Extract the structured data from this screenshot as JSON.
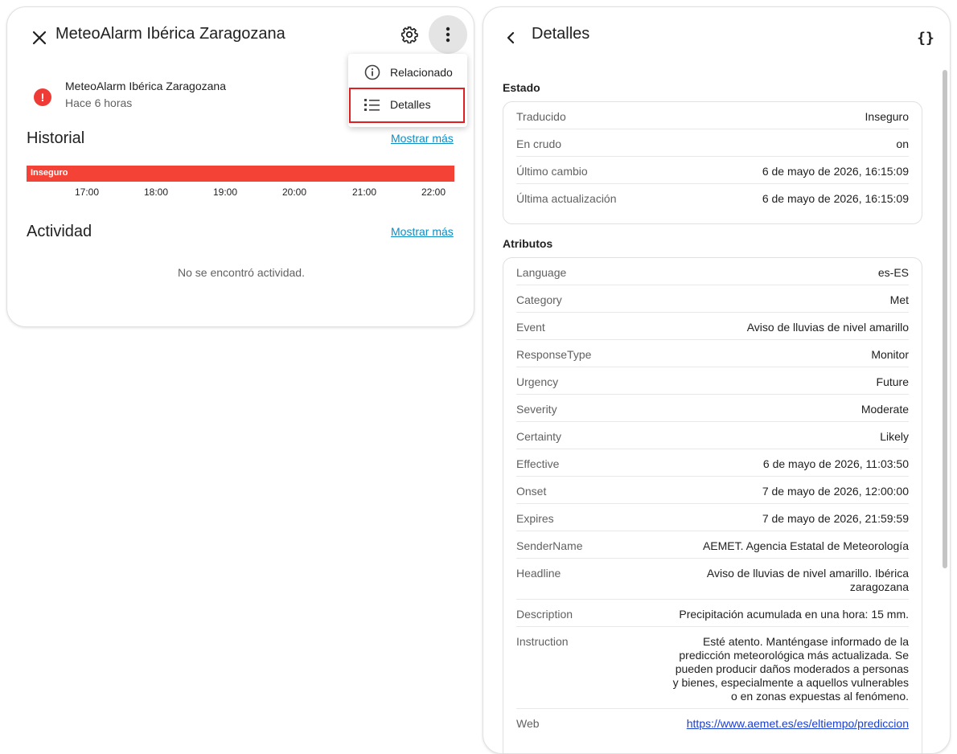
{
  "left_panel": {
    "title": "MeteoAlarm Ibérica Zaragozana",
    "entity": {
      "name": "MeteoAlarm Ibérica Zaragozana",
      "time": "Hace 6 horas"
    },
    "history": {
      "title": "Historial",
      "show_more": "Mostrar más",
      "state_label": "Inseguro",
      "ticks": [
        "17:00",
        "18:00",
        "19:00",
        "20:00",
        "21:00",
        "22:00"
      ]
    },
    "activity": {
      "title": "Actividad",
      "show_more": "Mostrar más",
      "empty": "No se encontró actividad."
    },
    "menu": {
      "related": "Relacionado",
      "details": "Detalles"
    }
  },
  "right_panel": {
    "title": "Detalles",
    "json_icon": "{}",
    "state": {
      "label": "Estado",
      "rows": [
        {
          "k": "Traducido",
          "v": "Inseguro"
        },
        {
          "k": "En crudo",
          "v": "on"
        },
        {
          "k": "Último cambio",
          "v": "6 de mayo de 2026, 16:15:09"
        },
        {
          "k": "Última actualización",
          "v": "6 de mayo de 2026, 16:15:09"
        }
      ]
    },
    "attributes": {
      "label": "Atributos",
      "rows": [
        {
          "k": "Language",
          "v": "es-ES"
        },
        {
          "k": "Category",
          "v": "Met"
        },
        {
          "k": "Event",
          "v": "Aviso de lluvias de nivel amarillo"
        },
        {
          "k": "ResponseType",
          "v": "Monitor"
        },
        {
          "k": "Urgency",
          "v": "Future"
        },
        {
          "k": "Severity",
          "v": "Moderate"
        },
        {
          "k": "Certainty",
          "v": "Likely"
        },
        {
          "k": "Effective",
          "v": "6 de mayo de 2026, 11:03:50"
        },
        {
          "k": "Onset",
          "v": "7 de mayo de 2026, 12:00:00"
        },
        {
          "k": "Expires",
          "v": "7 de mayo de 2026, 21:59:59"
        },
        {
          "k": "SenderName",
          "v": "AEMET. Agencia Estatal de Meteorología"
        },
        {
          "k": "Headline",
          "v": "Aviso de lluvias de nivel amarillo. Ibérica zaragozana"
        },
        {
          "k": "Description",
          "v": "Precipitación acumulada en una hora: 15 mm."
        },
        {
          "k": "Instruction",
          "v": "Esté atento. Manténgase informado de la predicción meteorológica más actualizada. Se pueden producir daños moderados a personas y bienes, especialmente a aquellos vulnerables o en zonas expuestas al fenómeno."
        },
        {
          "k": "Web",
          "v": "https://www.aemet.es/es/eltiempo/prediccion"
        }
      ]
    }
  },
  "colors": {
    "alert": "#ef3b36",
    "timeline": "#f44336",
    "link": "#0b8ec4",
    "highlight": "#e02020"
  }
}
